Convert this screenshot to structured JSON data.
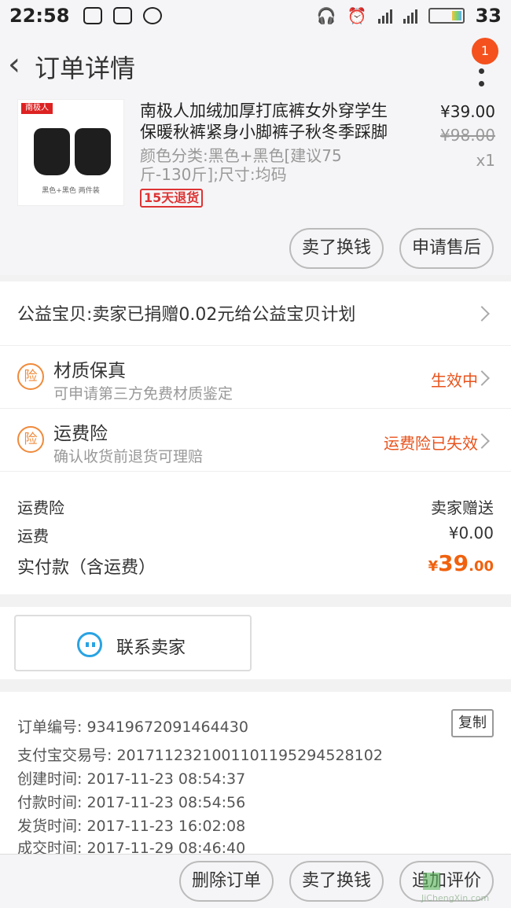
{
  "status_bar": {
    "time": "22:58",
    "battery": "33"
  },
  "header": {
    "title": "订单详情",
    "back_icon": "‹",
    "badge_count": "1"
  },
  "product": {
    "name": "南极人加绒加厚打底裤女外穿学生保暖秋裤紧身小脚裤子秋冬季踩脚",
    "spec": "颜色分类:黑色+黑色[建议75斤-130斤];尺寸:均码",
    "tag": "15天退货",
    "price": "¥39.00",
    "original_price": "¥98.00",
    "quantity": "x1",
    "image_brand": "南极人",
    "image_caption": "黑色+黑色 两件装",
    "buttons": {
      "sell": "卖了换钱",
      "after_sale": "申请售后"
    }
  },
  "charity": {
    "text": "公益宝贝:卖家已捐赠0.02元给公益宝贝计划"
  },
  "insurance": [
    {
      "icon": "险",
      "title": "材质保真",
      "desc": "可申请第三方免费材质鉴定",
      "status": "生效中"
    },
    {
      "icon": "险",
      "title": "运费险",
      "desc": "确认收货前退货可理赔",
      "status": "运费险已失效"
    }
  ],
  "costs": {
    "shipping_ins_label": "运费险",
    "shipping_ins_value": "卖家赠送",
    "shipping_label": "运费",
    "shipping_value": "¥0.00",
    "paid_label": "实付款（含运费）",
    "paid_currency": "¥",
    "paid_int": "39",
    "paid_dec": ".00"
  },
  "contact": {
    "label": "联系卖家"
  },
  "order_info": {
    "copy_label": "复制",
    "lines": [
      "订单编号: 93419672091464430",
      "支付宝交易号: 2017112321001101195294528102",
      "创建时间: 2017-11-23 08:54:37",
      "付款时间: 2017-11-23 08:54:56",
      "发货时间: 2017-11-23 16:02:08",
      "成交时间: 2017-11-29 08:46:40"
    ]
  },
  "bottom_bar": {
    "delete": "删除订单",
    "sell": "卖了换钱",
    "review": "追加评价"
  },
  "watermark": {
    "text": "JiChengXin.com"
  }
}
